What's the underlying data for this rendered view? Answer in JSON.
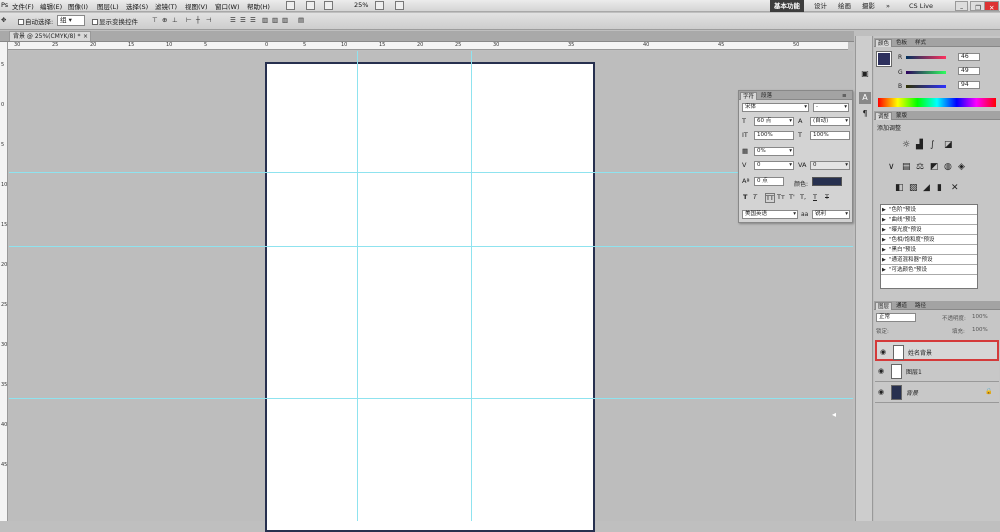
{
  "menu": {
    "items": [
      "文件(F)",
      "编辑(E)",
      "图像(I)",
      "图层(L)",
      "选择(S)",
      "滤镜(T)",
      "视图(V)",
      "窗口(W)",
      "帮助(H)"
    ],
    "zoom": "25%",
    "workspaces": [
      "基本功能",
      "设计",
      "绘画",
      "摄影"
    ],
    "cslive": "CS Live"
  },
  "options": {
    "auto_select_label": "自动选择:",
    "auto_select_value": "组",
    "show_transform_label": "显示变换控件"
  },
  "document": {
    "tab_title": "背景 @ 25%(CMYK/8) *",
    "hruler_labels": [
      "30",
      "25",
      "20",
      "15",
      "10",
      "5",
      "0",
      "5",
      "10",
      "15",
      "20",
      "25",
      "30",
      "35",
      "40",
      "45",
      "50"
    ],
    "vruler_labels": [
      "5",
      "0",
      "5",
      "10",
      "15",
      "20",
      "25",
      "30",
      "35",
      "40",
      "45"
    ]
  },
  "color_panel": {
    "tabs": [
      "颜色",
      "色板",
      "样式"
    ],
    "r_label": "R",
    "g_label": "G",
    "b_label": "B",
    "r": "46",
    "g": "49",
    "b": "94",
    "fg_color": "#2e315e"
  },
  "adjust_panel": {
    "tabs": [
      "调整",
      "蒙版"
    ],
    "title": "添加调整",
    "presets": [
      "\"色阶\"预设",
      "\"曲线\"预设",
      "\"曝光度\"预设",
      "\"色相/饱和度\"预设",
      "\"黑白\"预设",
      "\"通道混和器\"预设",
      "\"可选颜色\"预设"
    ]
  },
  "layers_panel": {
    "tabs": [
      "图层",
      "通道",
      "路径"
    ],
    "blend_mode": "正常",
    "opacity_label": "不透明度:",
    "opacity": "100%",
    "lock_label": "锁定:",
    "fill_label": "填充:",
    "fill": "100%",
    "layers": [
      {
        "name": "姓名背景",
        "selected": true,
        "thumb": "#ffffff"
      },
      {
        "name": "图层1",
        "selected": false,
        "thumb": "#ffffff"
      },
      {
        "name": "背景",
        "selected": false,
        "thumb": "#27304f"
      }
    ]
  },
  "character_panel": {
    "tabs": [
      "字符",
      "段落"
    ],
    "font": "宋体",
    "style": "-",
    "size": "60 点",
    "leading": "(自动)",
    "vscale": "100%",
    "hscale": "100%",
    "tsume": "0%",
    "tracking": "0",
    "kerning": "0",
    "baseline": "0 点",
    "color_label": "颜色:",
    "color": "#27304f",
    "language": "美国英语",
    "aa_label": "aa",
    "aa": "锐利"
  }
}
